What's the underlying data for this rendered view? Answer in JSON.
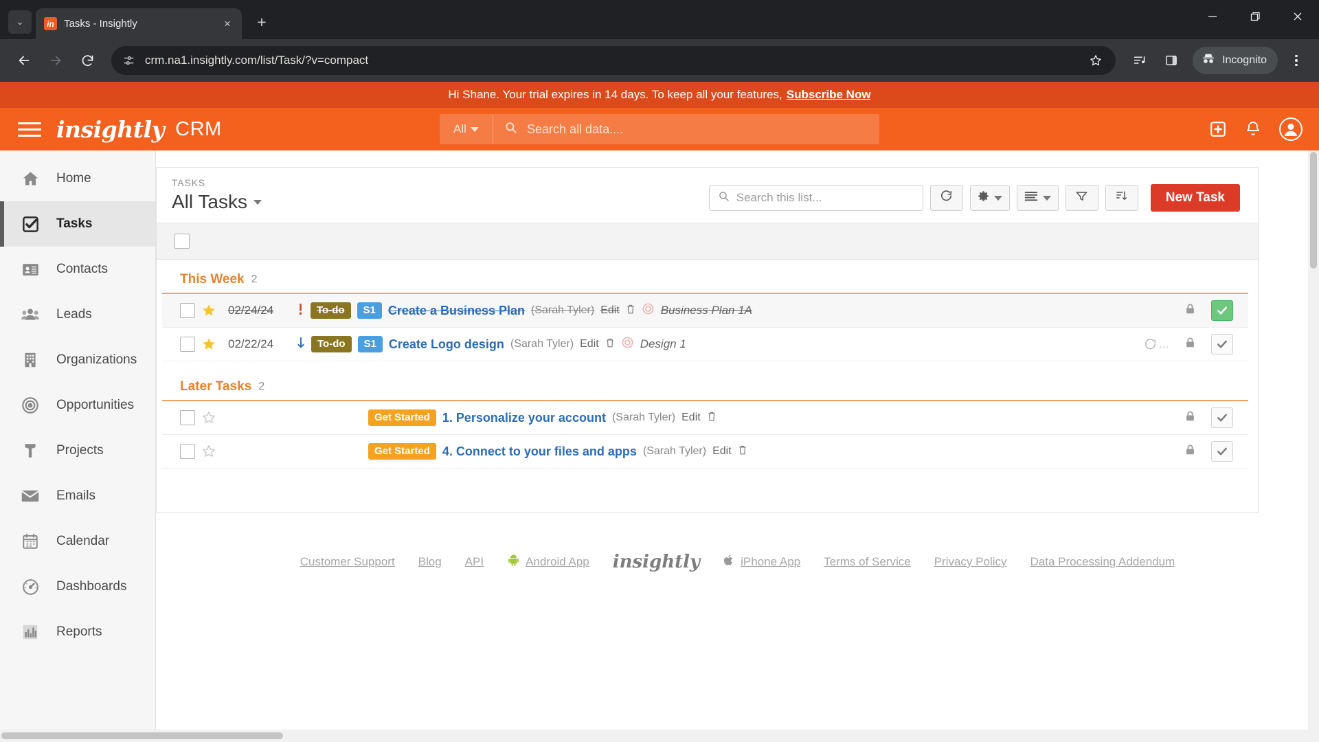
{
  "browser": {
    "tab": {
      "title": "Tasks - Insightly",
      "favicon_text": "in",
      "close_label": "×"
    },
    "new_tab_label": "+",
    "tab_list_chevron": "⌄",
    "window": {
      "minimize": "—",
      "maximize": "❐",
      "close": "✕"
    },
    "nav": {
      "back": "←",
      "forward": "→",
      "reload": "⟳"
    },
    "url": "crm.na1.insightly.com/list/Task/?v=compact",
    "profile_label": "Incognito",
    "icons": {
      "site_info": "site-info-icon",
      "bookmark": "star-icon",
      "reading_list": "reading-list-icon",
      "side_panel": "side-panel-icon",
      "incognito": "incognito-icon",
      "menu": "kebab-menu-icon"
    }
  },
  "banner": {
    "text": "Hi Shane. Your trial expires in 14 days. To keep all your features,",
    "cta": "Subscribe Now",
    "bg_color": "#dc4a1c"
  },
  "header": {
    "brand": "insightly",
    "product": "CRM",
    "bg_color": "#f4601e",
    "search": {
      "scope": "All",
      "placeholder": "Search all data....",
      "value": ""
    },
    "actions": {
      "add": "+",
      "notifications": "bell-icon",
      "profile": "user-avatar"
    }
  },
  "sidebar": {
    "items": [
      {
        "label": "Home",
        "icon": "home-icon",
        "active": false
      },
      {
        "label": "Tasks",
        "icon": "tasks-icon",
        "active": true
      },
      {
        "label": "Contacts",
        "icon": "contacts-icon",
        "active": false
      },
      {
        "label": "Leads",
        "icon": "leads-icon",
        "active": false
      },
      {
        "label": "Organizations",
        "icon": "organizations-icon",
        "active": false
      },
      {
        "label": "Opportunities",
        "icon": "opportunities-icon",
        "active": false
      },
      {
        "label": "Projects",
        "icon": "projects-icon",
        "active": false
      },
      {
        "label": "Emails",
        "icon": "emails-icon",
        "active": false
      },
      {
        "label": "Calendar",
        "icon": "calendar-icon",
        "active": false
      },
      {
        "label": "Dashboards",
        "icon": "dashboards-icon",
        "active": false
      },
      {
        "label": "Reports",
        "icon": "reports-icon",
        "active": false
      }
    ]
  },
  "list_header": {
    "eyebrow": "TASKS",
    "title": "All Tasks",
    "search_placeholder": "Search this list...",
    "search_value": "",
    "buttons": {
      "refresh": "refresh-icon",
      "settings": "gear-icon",
      "view": "list-view-icon",
      "filter": "filter-icon",
      "sort": "sort-icon",
      "new_task": "New Task"
    },
    "new_task_color": "#dc3b28"
  },
  "groups": [
    {
      "label": "This Week",
      "count": "2",
      "rows": [
        {
          "date": "02/24/24",
          "starred": true,
          "priority_icon": "high-priority-icon",
          "status": "To-do",
          "stage": "S1",
          "title": "Create a Business Plan",
          "owner": "(Sarah Tyler)",
          "edit": "Edit",
          "delete_icon": "trash-icon",
          "linked_icon": "opportunity-icon",
          "linked": "Business Plan 1A",
          "completed": true,
          "pending_icon": "",
          "lock_icon": "lock-icon",
          "complete_icon": "check-icon"
        },
        {
          "date": "02/22/24",
          "starred": true,
          "priority_icon": "low-priority-icon",
          "status": "To-do",
          "stage": "S1",
          "title": "Create Logo design",
          "owner": "(Sarah Tyler)",
          "edit": "Edit",
          "delete_icon": "trash-icon",
          "linked_icon": "opportunity-icon",
          "linked": "Design 1",
          "completed": false,
          "pending_icon": "spinner-icon",
          "lock_icon": "lock-icon",
          "complete_icon": "check-icon"
        }
      ]
    },
    {
      "label": "Later Tasks",
      "count": "2",
      "rows": [
        {
          "date": "",
          "starred": false,
          "priority_icon": "",
          "status": "Get Started",
          "stage": "",
          "title": "1. Personalize your account",
          "owner": "(Sarah Tyler)",
          "edit": "Edit",
          "delete_icon": "trash-icon",
          "linked_icon": "",
          "linked": "",
          "completed": false,
          "pending_icon": "",
          "lock_icon": "lock-icon",
          "complete_icon": "check-icon"
        },
        {
          "date": "",
          "starred": false,
          "priority_icon": "",
          "status": "Get Started",
          "stage": "",
          "title": "4. Connect to your files and apps",
          "owner": "(Sarah Tyler)",
          "edit": "Edit",
          "delete_icon": "trash-icon",
          "linked_icon": "",
          "linked": "",
          "completed": false,
          "pending_icon": "",
          "lock_icon": "lock-icon",
          "complete_icon": "check-icon"
        }
      ]
    }
  ],
  "footer": {
    "links_left": [
      "Customer Support",
      "Blog",
      "API"
    ],
    "android": "Android App",
    "logo": "insightly",
    "iphone": "iPhone App",
    "links_right": [
      "Terms of Service",
      "Privacy Policy",
      "Data Processing Addendum"
    ]
  }
}
